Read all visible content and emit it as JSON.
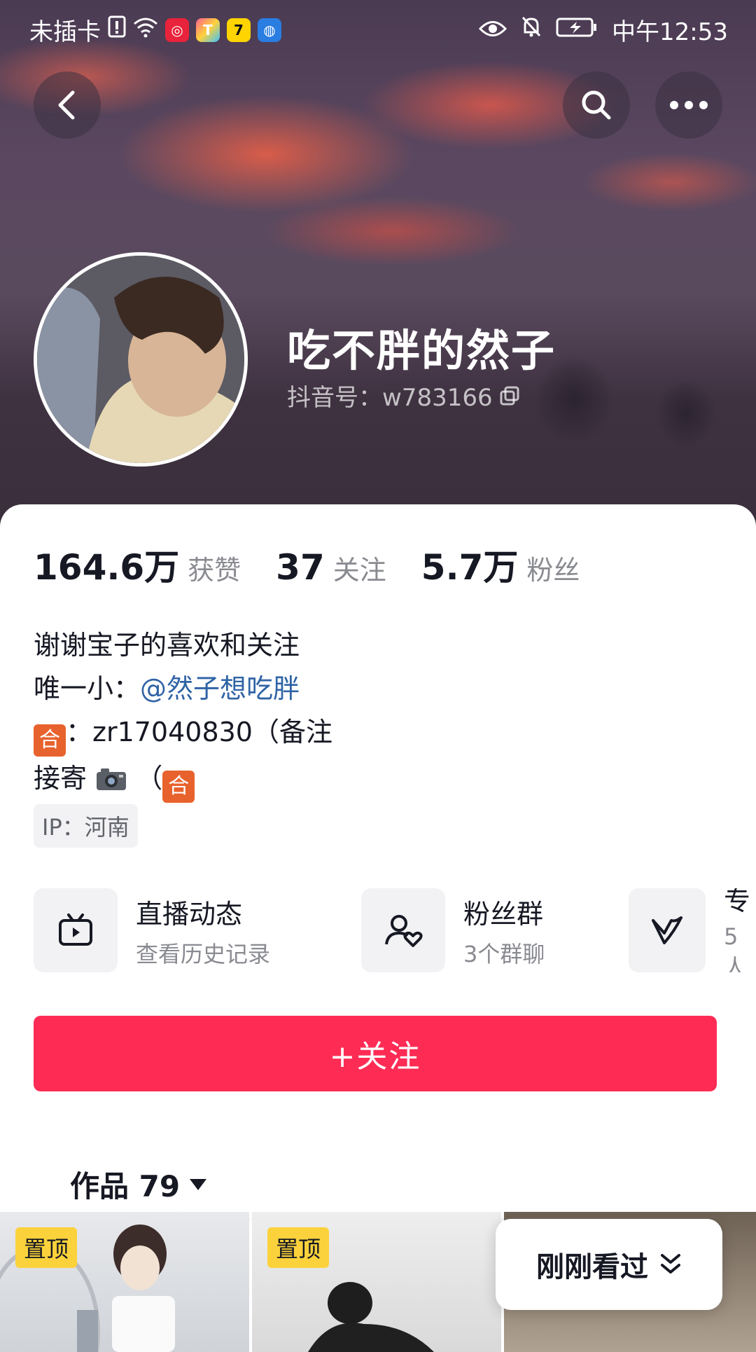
{
  "status_bar": {
    "carrier": "未插卡",
    "time": "中午12:53"
  },
  "profile": {
    "nickname": "吃不胖的然子",
    "douyin_id": "抖音号：w783166"
  },
  "stats": [
    {
      "num": "164.6万",
      "label": "获赞"
    },
    {
      "num": "37",
      "label": "关注"
    },
    {
      "num": "5.7万",
      "label": "粉丝"
    }
  ],
  "bio": {
    "line1": "谢谢宝子的喜欢和关注",
    "line2_prefix": "唯一小：",
    "line2_mention": "@然子想吃胖",
    "line3_icon": "合",
    "line3_text": "：zr17040830（备注",
    "line4_prefix": "接寄",
    "line4_suffix": "（",
    "line4_icon": "合"
  },
  "ip": "IP：河南",
  "cards": [
    {
      "title": "直播动态",
      "subtitle": "查看历史记录",
      "icon": "tv-icon"
    },
    {
      "title": "粉丝群",
      "subtitle": "3个群聊",
      "icon": "fan-group-icon"
    },
    {
      "title": "专",
      "subtitle": "5人",
      "icon": "v-icon"
    }
  ],
  "follow_button": "+关注",
  "tab": {
    "label": "作品 79"
  },
  "thumbs": [
    {
      "badge": "置顶"
    },
    {
      "badge": "置顶"
    },
    {
      "badge": ""
    }
  ],
  "recent_viewed": "刚刚看过",
  "colors": {
    "accent": "#fe2c55",
    "mention": "#2f63a5",
    "pin": "#fbd23b"
  }
}
